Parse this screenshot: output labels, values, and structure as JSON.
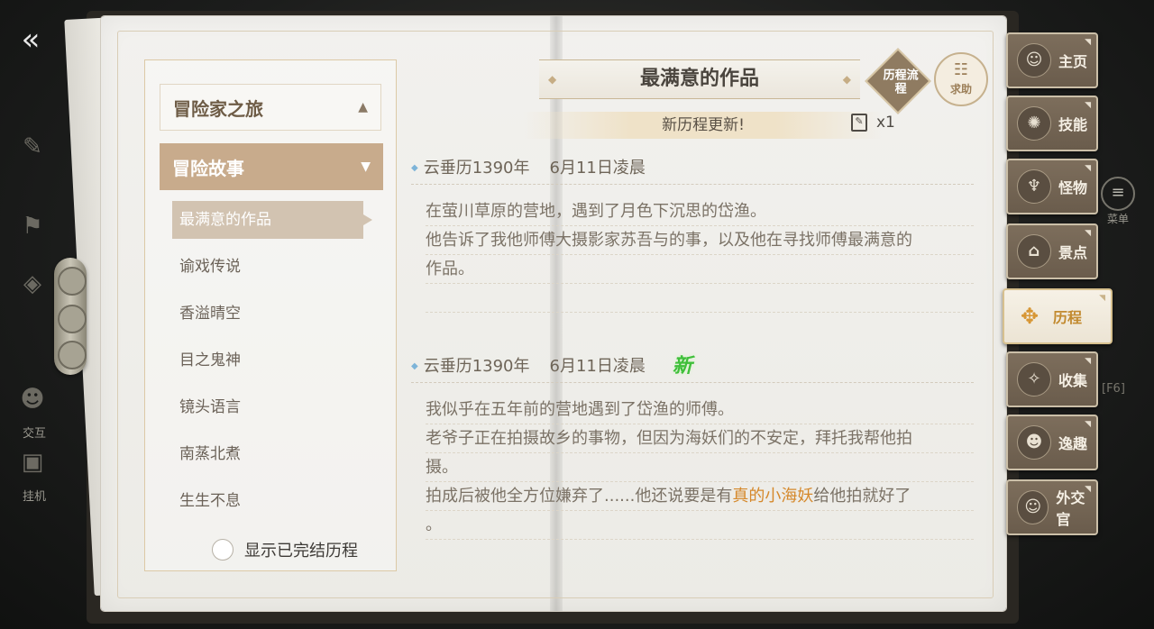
{
  "hud": {
    "interact_label": "交互",
    "idle_label": "挂机",
    "menu_label": "菜单",
    "f6_hint": "[F6]",
    "back_icon": "back-arrow-icon"
  },
  "sidebar": {
    "category": "冒险家之旅",
    "subcategory": "冒险故事",
    "stories": [
      {
        "label": "最满意的作品",
        "active": true
      },
      {
        "label": "谕戏传说"
      },
      {
        "label": "香溢晴空"
      },
      {
        "label": "目之鬼神"
      },
      {
        "label": "镜头语言"
      },
      {
        "label": "南蒸北煮"
      },
      {
        "label": "生生不息"
      }
    ],
    "show_completed": "显示已完结历程"
  },
  "header": {
    "title": "最满意的作品",
    "flow_button": "历程流程",
    "help_button": "求助",
    "update_text": "新历程更新!",
    "update_count": "x1"
  },
  "entries": [
    {
      "date": "云垂历1390年",
      "time": "6月11日凌晨",
      "lines": [
        "在萤川草原的营地，遇到了月色下沉思的岱渔。",
        "他告诉了我他师傅大摄影家苏吾与的事，以及他在寻找师傅最满意的",
        "作品。"
      ]
    },
    {
      "date": "云垂历1390年",
      "time": "6月11日凌晨",
      "badge": "新",
      "lines": [
        "我似乎在五年前的营地遇到了岱渔的师傅。",
        "老爷子正在拍摄故乡的事物，但因为海妖们的不安定，拜托我帮他拍",
        "摄。"
      ],
      "last_line_pre": "拍成后被他全方位嫌弃了......他还说要是有",
      "last_line_highlight": "真的小海妖",
      "last_line_post": "给他拍就好了",
      "final_line": "。",
      "highlight_color": "#d5882b"
    }
  ],
  "tabs": [
    {
      "label": "主页",
      "icon": "home-icon"
    },
    {
      "label": "技能",
      "icon": "skill-icon"
    },
    {
      "label": "怪物",
      "icon": "monster-icon"
    },
    {
      "label": "景点",
      "icon": "landmark-icon"
    },
    {
      "label": "历程",
      "icon": "journey-icon",
      "active": true
    },
    {
      "label": "收集",
      "icon": "collect-icon"
    },
    {
      "label": "逸趣",
      "icon": "fun-icon"
    },
    {
      "label": "外交官",
      "icon": "diplomat-icon"
    }
  ]
}
